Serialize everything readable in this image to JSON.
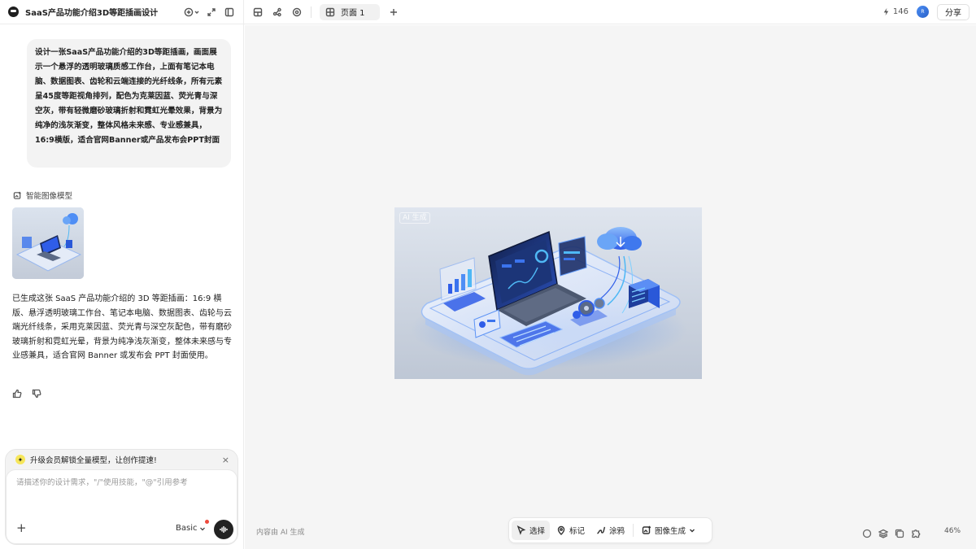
{
  "app": {
    "title": "SaaS产品功能介绍3D等距插画设计"
  },
  "header": {
    "page_tab": "页面 1",
    "credits": "146",
    "avatar_text": "R",
    "share_label": "分享"
  },
  "chat": {
    "user_prompt": "设计一张SaaS产品功能介绍的3D等距插画，画面展示一个悬浮的透明玻璃质感工作台，上面有笔记本电脑、数据图表、齿轮和云端连接的光纤线条，所有元素呈45度等距视角排列，配色为克莱因蓝、荧光青与深空灰，带有轻微磨砂玻璃折射和霓虹光晕效果，背景为纯净的浅灰渐变，整体风格未来感、专业感兼具，16:9横版，适合官网Banner或产品发布会PPT封面",
    "model_label": "智能图像模型",
    "ai_reply": "已生成这张 SaaS 产品功能介绍的 3D 等距插画：16:9 横版、悬浮透明玻璃工作台、笔记本电脑、数据图表、齿轮与云端光纤线条，采用克莱因蓝、荧光青与深空灰配色，带有磨砂玻璃折射和霓虹光晕，背景为纯净浅灰渐变，整体未来感与专业感兼具，适合官网 Banner 或发布会 PPT 封面使用。"
  },
  "composer": {
    "promo_text": "升级会员解锁全量模型，让创作提速!",
    "placeholder": "请描述你的设计需求，\"/\"使用技能，\"@\"引用参考",
    "mode_label": "Basic"
  },
  "canvas": {
    "ai_tag": "AI 生成",
    "ai_note": "内容由 AI 生成",
    "tools": {
      "select": "选择",
      "mark": "标记",
      "draw": "涂鸦",
      "image_gen": "图像生成"
    },
    "zoom": "46%"
  },
  "colors": {
    "klein_blue": "#2f5de8",
    "cyan": "#4fb8f5",
    "glass": "#e8eefa"
  }
}
